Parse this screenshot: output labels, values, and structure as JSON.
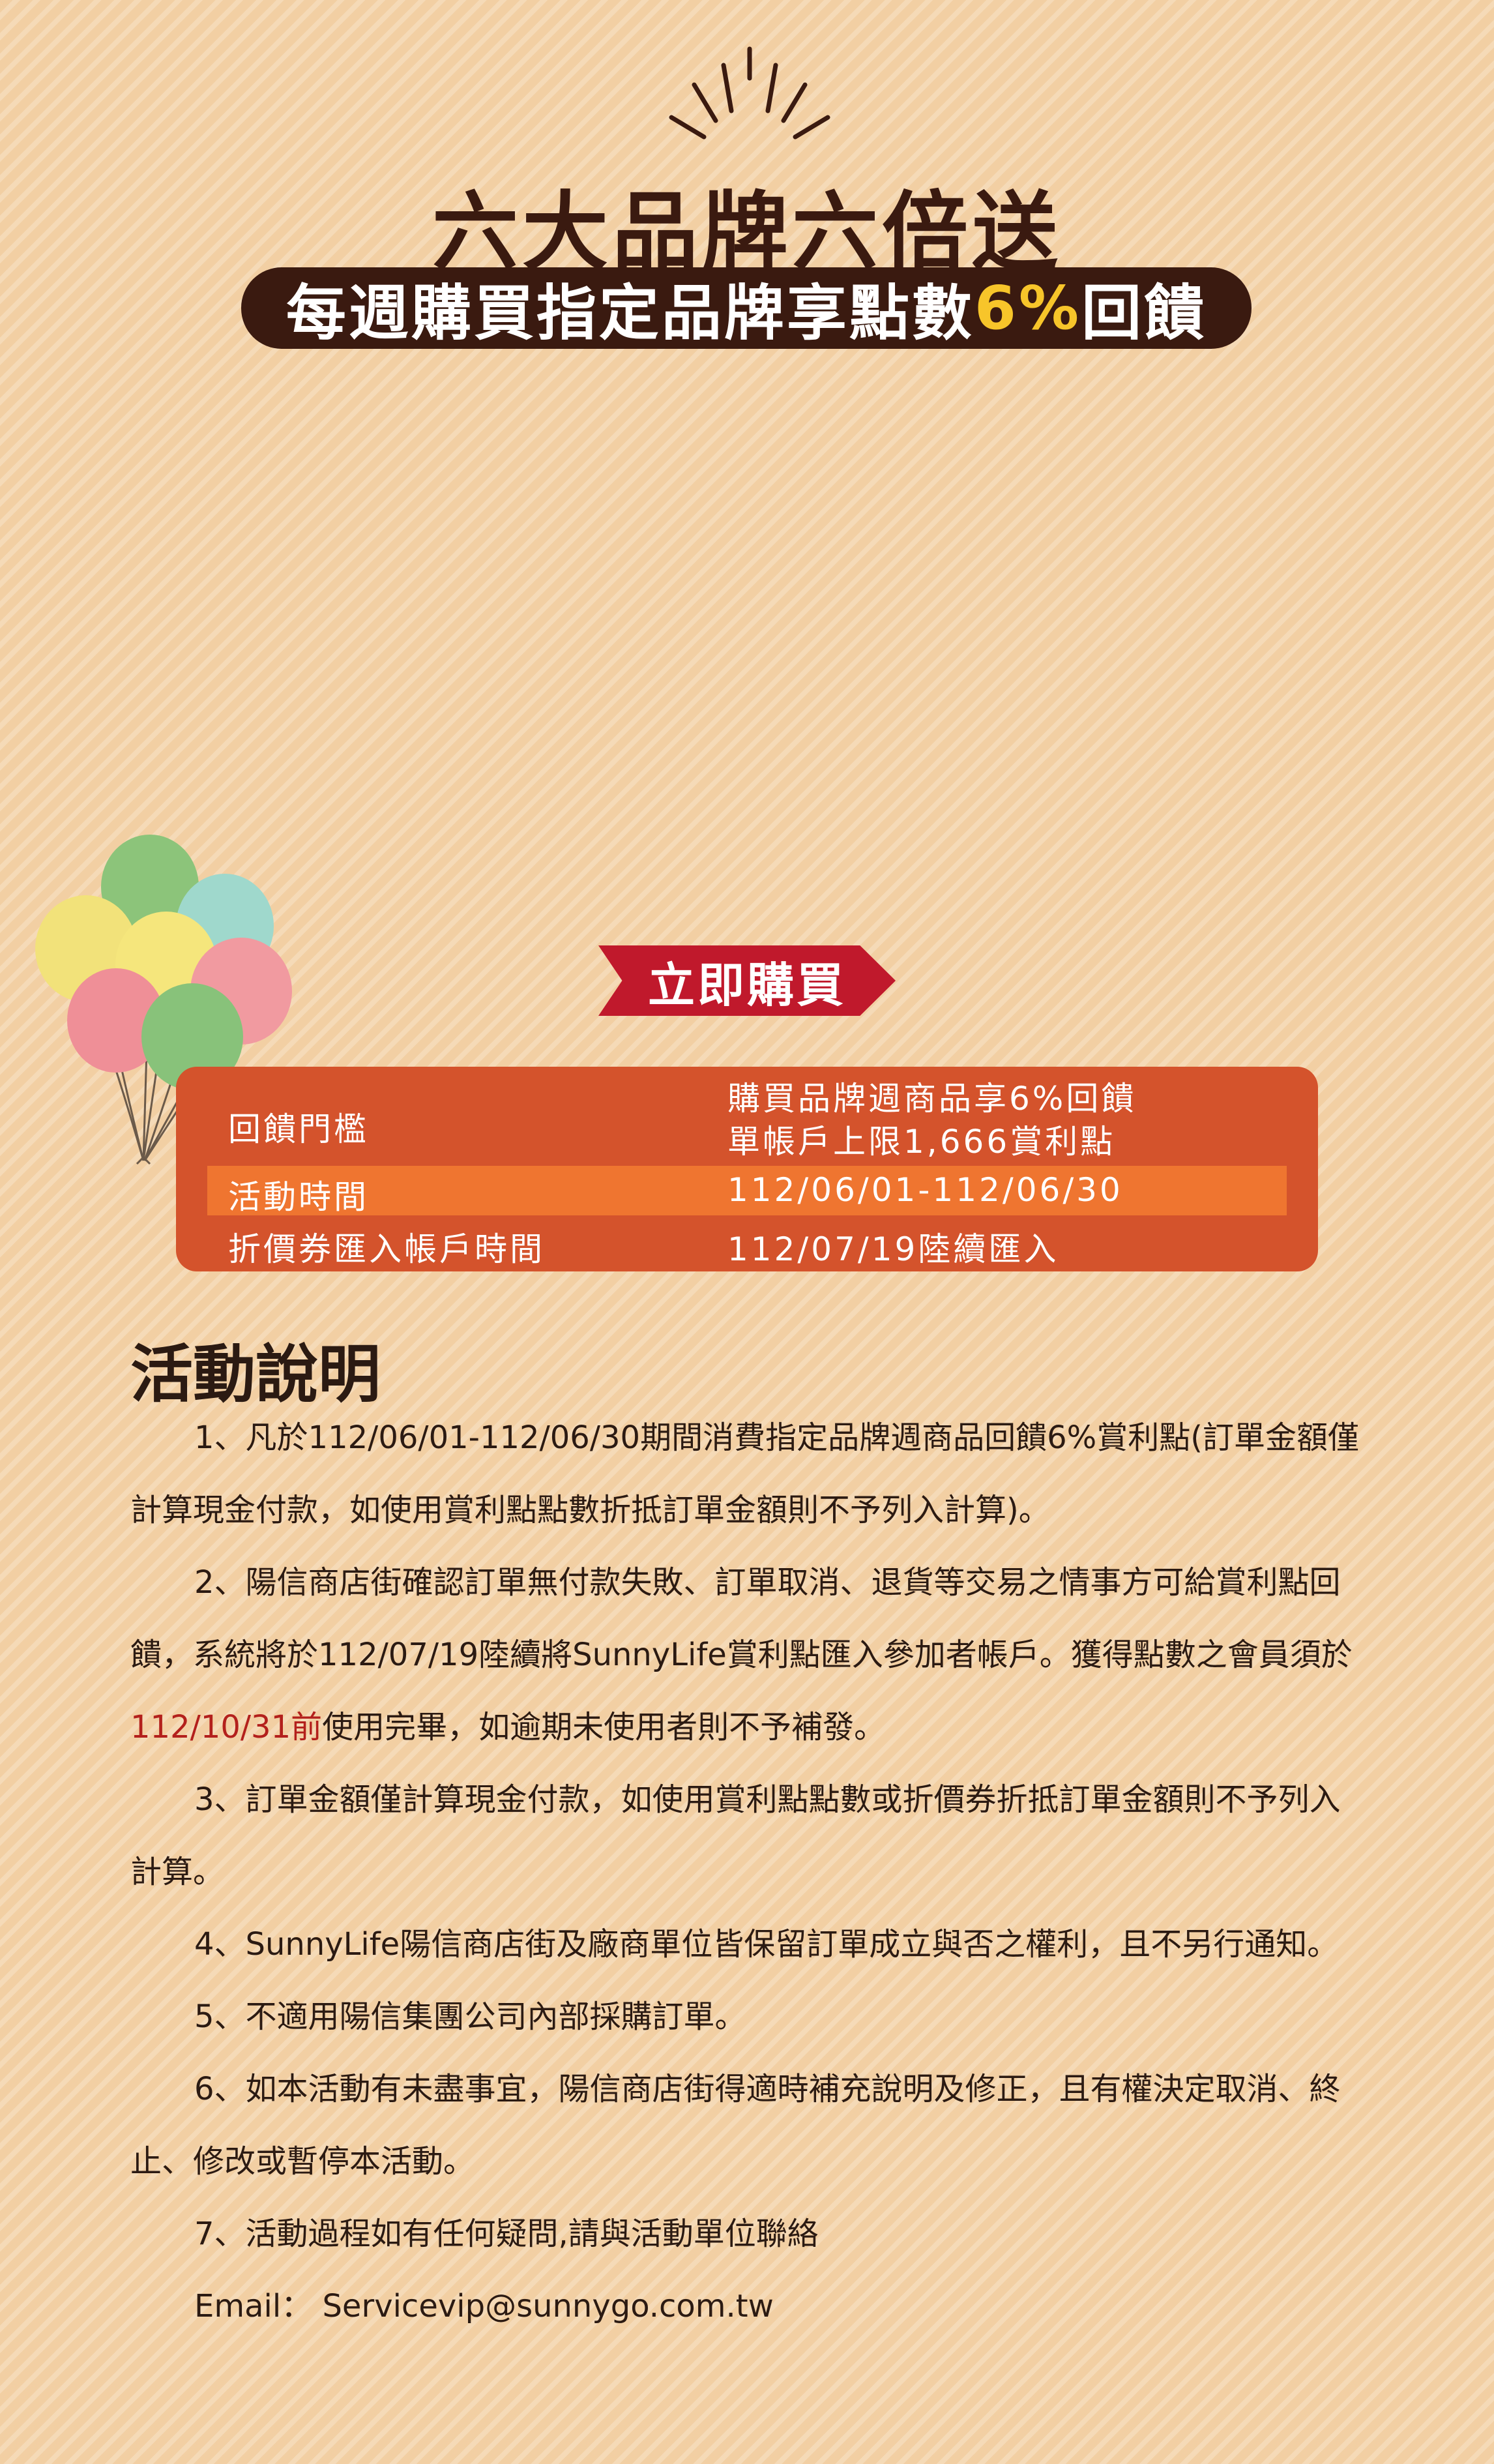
{
  "header": {
    "title": "六大品牌六倍送",
    "subtitle_pre": "每週購買指定品牌享點數",
    "subtitle_highlight": "6%",
    "subtitle_post": "回饋"
  },
  "buy_button": {
    "label": "立即購買"
  },
  "info": {
    "rows": [
      {
        "label": "回饋門檻",
        "value_line1": "購買品牌週商品享6%回饋",
        "value_line2": "單帳戶上限1,666賞利點"
      },
      {
        "label": "活動時間",
        "value": "112/06/01-112/06/30"
      },
      {
        "label": "折價券匯入帳戶時間",
        "value": "112/07/19陸續匯入"
      }
    ]
  },
  "description": {
    "title": "活動說明",
    "item1": "1、凡於112/06/01-112/06/30期間消費指定品牌週商品回饋6%賞利點(訂單金額僅計算現金付款，如使用賞利點點數折抵訂單金額則不予列入計算)。",
    "item2_pre": "2、陽信商店街確認訂單無付款失敗、訂單取消、退貨等交易之情事方可給賞利點回饋，系統將於112/07/19陸續將SunnyLife賞利點匯入參加者帳戶。獲得點數之會員須於",
    "item2_red": "112/10/31前",
    "item2_post": "使用完畢，如逾期未使用者則不予補發。",
    "item3": "3、訂單金額僅計算現金付款，如使用賞利點點數或折價券折抵訂單金額則不予列入計算。",
    "item4": "4、SunnyLife陽信商店街及廠商單位皆保留訂單成立與否之權利，且不另行通知。",
    "item5": "5、不適用陽信集團公司內部採購訂單。",
    "item6": "6、如本活動有未盡事宜，陽信商店街得適時補充說明及修正，且有權決定取消、終止、修改或暫停本活動。",
    "item7": "7、活動過程如有任何疑問,請與活動單位聯絡",
    "email_label": "Email：",
    "email_value": "Servicevip@sunnygo.com.tw"
  },
  "colors": {
    "background": "#f2cfa3",
    "dark_brown": "#3a1a10",
    "highlight_yellow": "#f7c52a",
    "buy_red": "#c0192c",
    "box_orange": "#d4532c",
    "row_orange": "#ef7530",
    "date_red": "#b3201c"
  }
}
